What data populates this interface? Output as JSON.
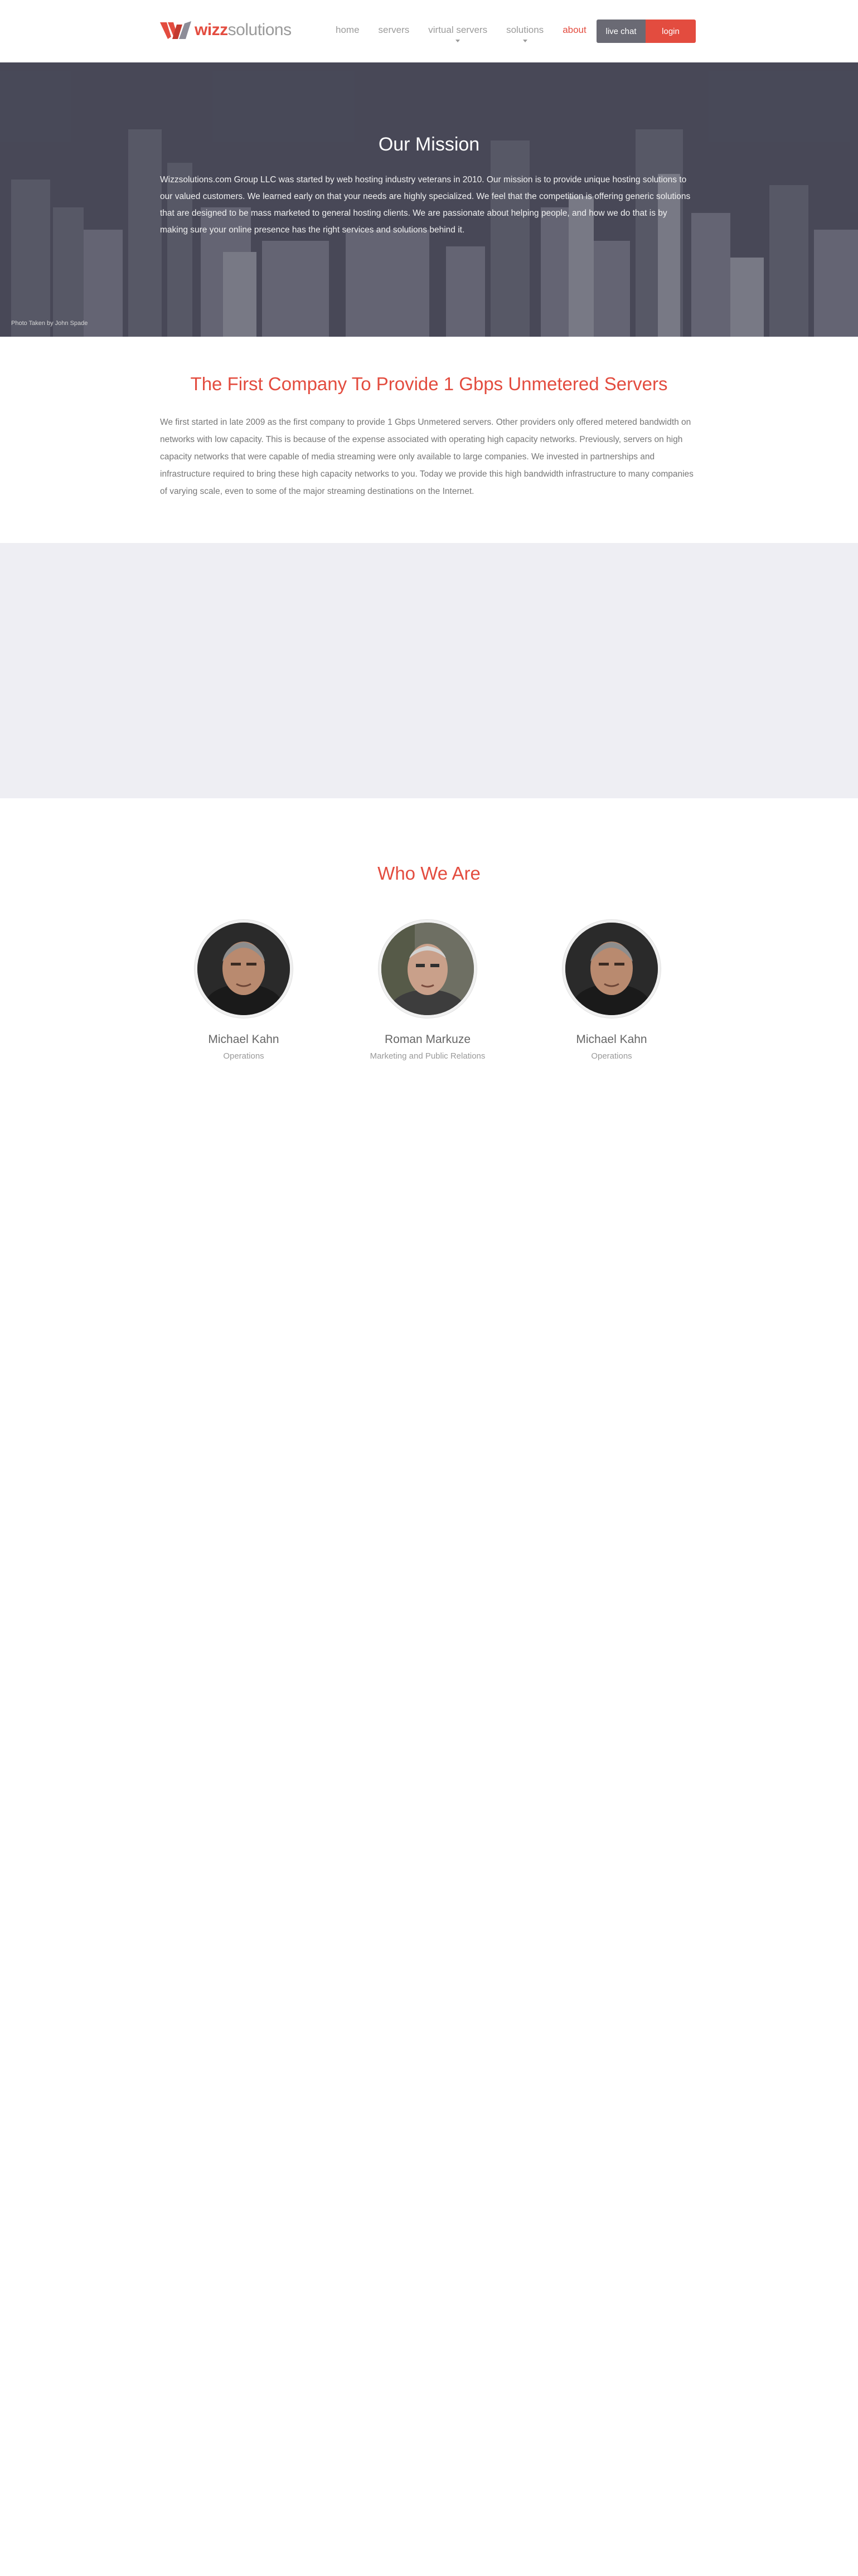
{
  "header": {
    "logo": {
      "word1": "wizz",
      "word2": "solutions"
    },
    "nav": [
      {
        "label": "home",
        "active": false,
        "dropdown": false
      },
      {
        "label": "servers",
        "active": false,
        "dropdown": false
      },
      {
        "label": "virtual servers",
        "active": false,
        "dropdown": true
      },
      {
        "label": "solutions",
        "active": false,
        "dropdown": true
      },
      {
        "label": "about",
        "active": true,
        "dropdown": false
      }
    ],
    "live_chat_label": "live chat",
    "login_label": "login"
  },
  "hero": {
    "title": "Our Mission",
    "text": "Wizzsolutions.com Group LLC was started by web hosting industry veterans in 2010. Our mission is to provide unique hosting solutions to our valued customers. We learned early on that your needs are highly specialized. We feel that the competition is offering generic solutions that are designed to be mass marketed to general hosting clients. We are passionate about helping people, and how we do that is by making sure your online presence has the right services and solutions behind it.",
    "photo_credit": "Photo Taken by John Spade"
  },
  "first_company": {
    "title": "The First Company To Provide 1 Gbps Unmetered Servers",
    "text": "We first started in late 2009 as the first company to provide 1 Gbps Unmetered servers. Other providers only offered metered bandwidth on networks with low capacity. This is because of the expense associated with operating high capacity networks. Previously, servers on high capacity networks that were capable of media streaming were only available to large companies. We invested in partnerships and infrastructure required to bring these high capacity networks to you. Today we provide this high bandwidth infrastructure to many companies of varying scale, even to some of the major streaming destinations on the Internet."
  },
  "who_we_are": {
    "title": "Who We Are",
    "members": [
      {
        "name": "Michael Kahn",
        "role": "Operations"
      },
      {
        "name": "Roman Markuze",
        "role": "Marketing and Public Relations"
      },
      {
        "name": "Michael Kahn",
        "role": "Operations"
      }
    ]
  },
  "colors": {
    "accent": "#e34c3f",
    "nav_text": "#9b9b9b",
    "chat_button": "#6a6a74",
    "band": "#eeeef3"
  }
}
